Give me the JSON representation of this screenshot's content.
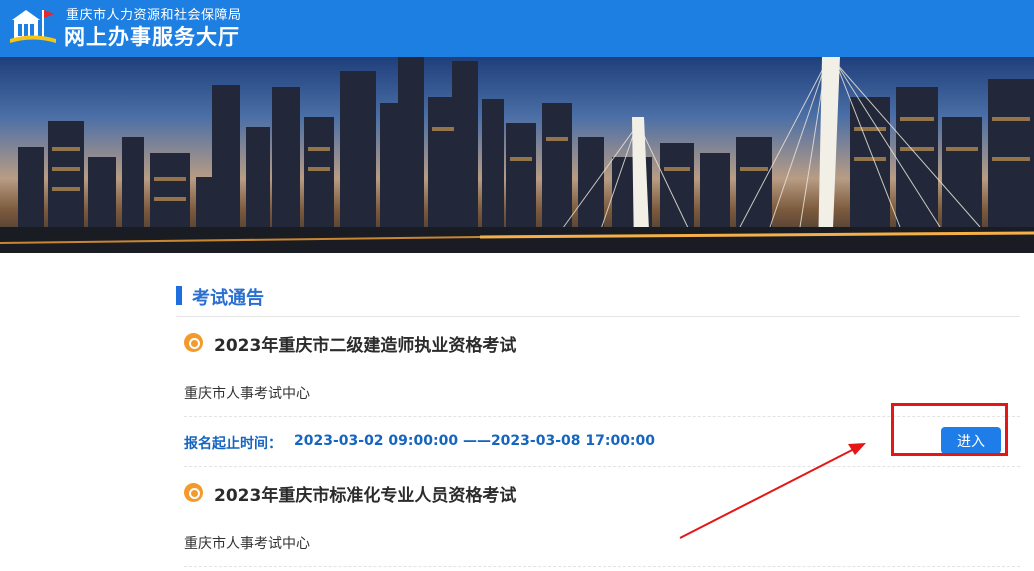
{
  "header": {
    "org_name": "重庆市人力资源和社会保障局",
    "hall_name": "网上办事服务大厅",
    "logo": "building-flag-logo"
  },
  "banner": {
    "image": "chongqing-skyline-photo"
  },
  "section": {
    "title": "考试通告"
  },
  "exams": [
    {
      "title": "2023年重庆市二级建造师执业资格考试",
      "organizer": "重庆市人事考试中心",
      "time_label": "报名起止时间：",
      "time_value": "2023-03-02 09:00:00 ——2023-03-08 17:00:00",
      "enter_label": "进入"
    },
    {
      "title": "2023年重庆市标准化专业人员资格考试",
      "organizer": "重庆市人事考试中心"
    }
  ],
  "colors": {
    "header_blue": "#1d7fe2",
    "title_blue": "#2a6fd0",
    "time_blue": "#1565c0",
    "icon_orange": "#f39a2b",
    "highlight_red": "#e41616"
  }
}
